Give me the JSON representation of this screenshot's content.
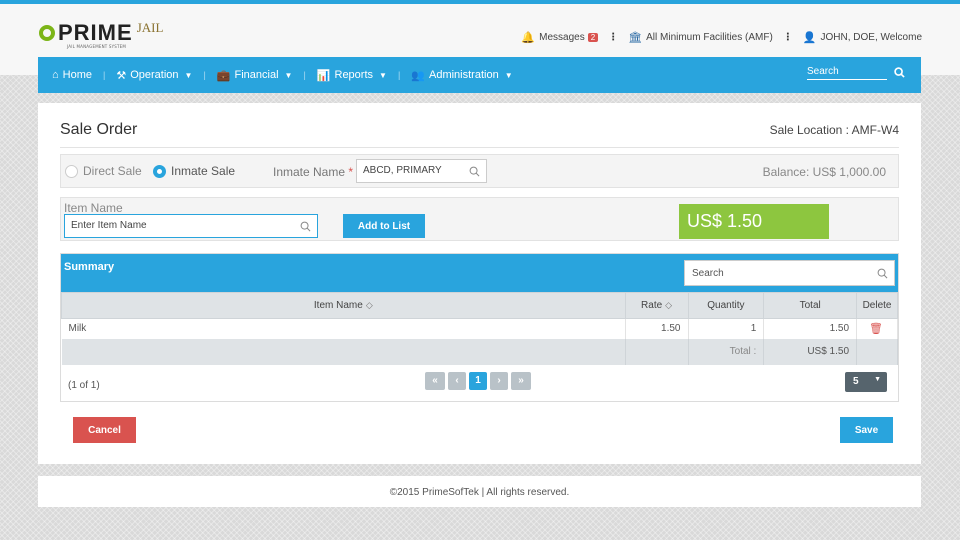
{
  "brand": {
    "prime": "PRIME",
    "jail": "JAIL",
    "tagline": "JAIL MANAGEMENT SYSTEM"
  },
  "topbar": {
    "messages_label": "Messages",
    "messages_count": "2",
    "facility": "All Minimum Facilities (AMF)",
    "user_welcome": "JOHN, DOE, Welcome"
  },
  "nav": {
    "items": [
      "Home",
      "Operation",
      "Financial",
      "Reports",
      "Administration"
    ],
    "search_placeholder": "Search"
  },
  "page": {
    "title": "Sale Order",
    "sale_location": "Sale Location : AMF-W4"
  },
  "sale_type": {
    "options": [
      "Direct Sale",
      "Inmate Sale"
    ],
    "selected": "Inmate Sale",
    "inmate_label": "Inmate Name",
    "inmate_value": "ABCD, PRIMARY",
    "balance": "Balance: US$ 1,000.00"
  },
  "item_entry": {
    "label": "Item Name",
    "placeholder": "Enter Item Name",
    "add_button": "Add to List",
    "price": "US$ 1.50",
    "price_color": "#8dc63f"
  },
  "summary": {
    "title": "Summary",
    "search_placeholder": "Search",
    "columns": [
      "Item Name",
      "Rate",
      "Quantity",
      "Total",
      "Delete"
    ],
    "rows": [
      {
        "item": "Milk",
        "rate": "1.50",
        "quantity": "1",
        "total": "1.50"
      }
    ],
    "total_label": "Total :",
    "total_value": "US$ 1.50",
    "page_info": "(1 of 1)",
    "current_page": "1",
    "page_size": "5"
  },
  "actions": {
    "cancel": "Cancel",
    "save": "Save"
  },
  "footer": {
    "text": "©2015 PrimeSofTek | All rights reserved."
  },
  "colors": {
    "accent": "#29a4dd",
    "danger": "#d9534f",
    "success": "#8dc63f"
  }
}
